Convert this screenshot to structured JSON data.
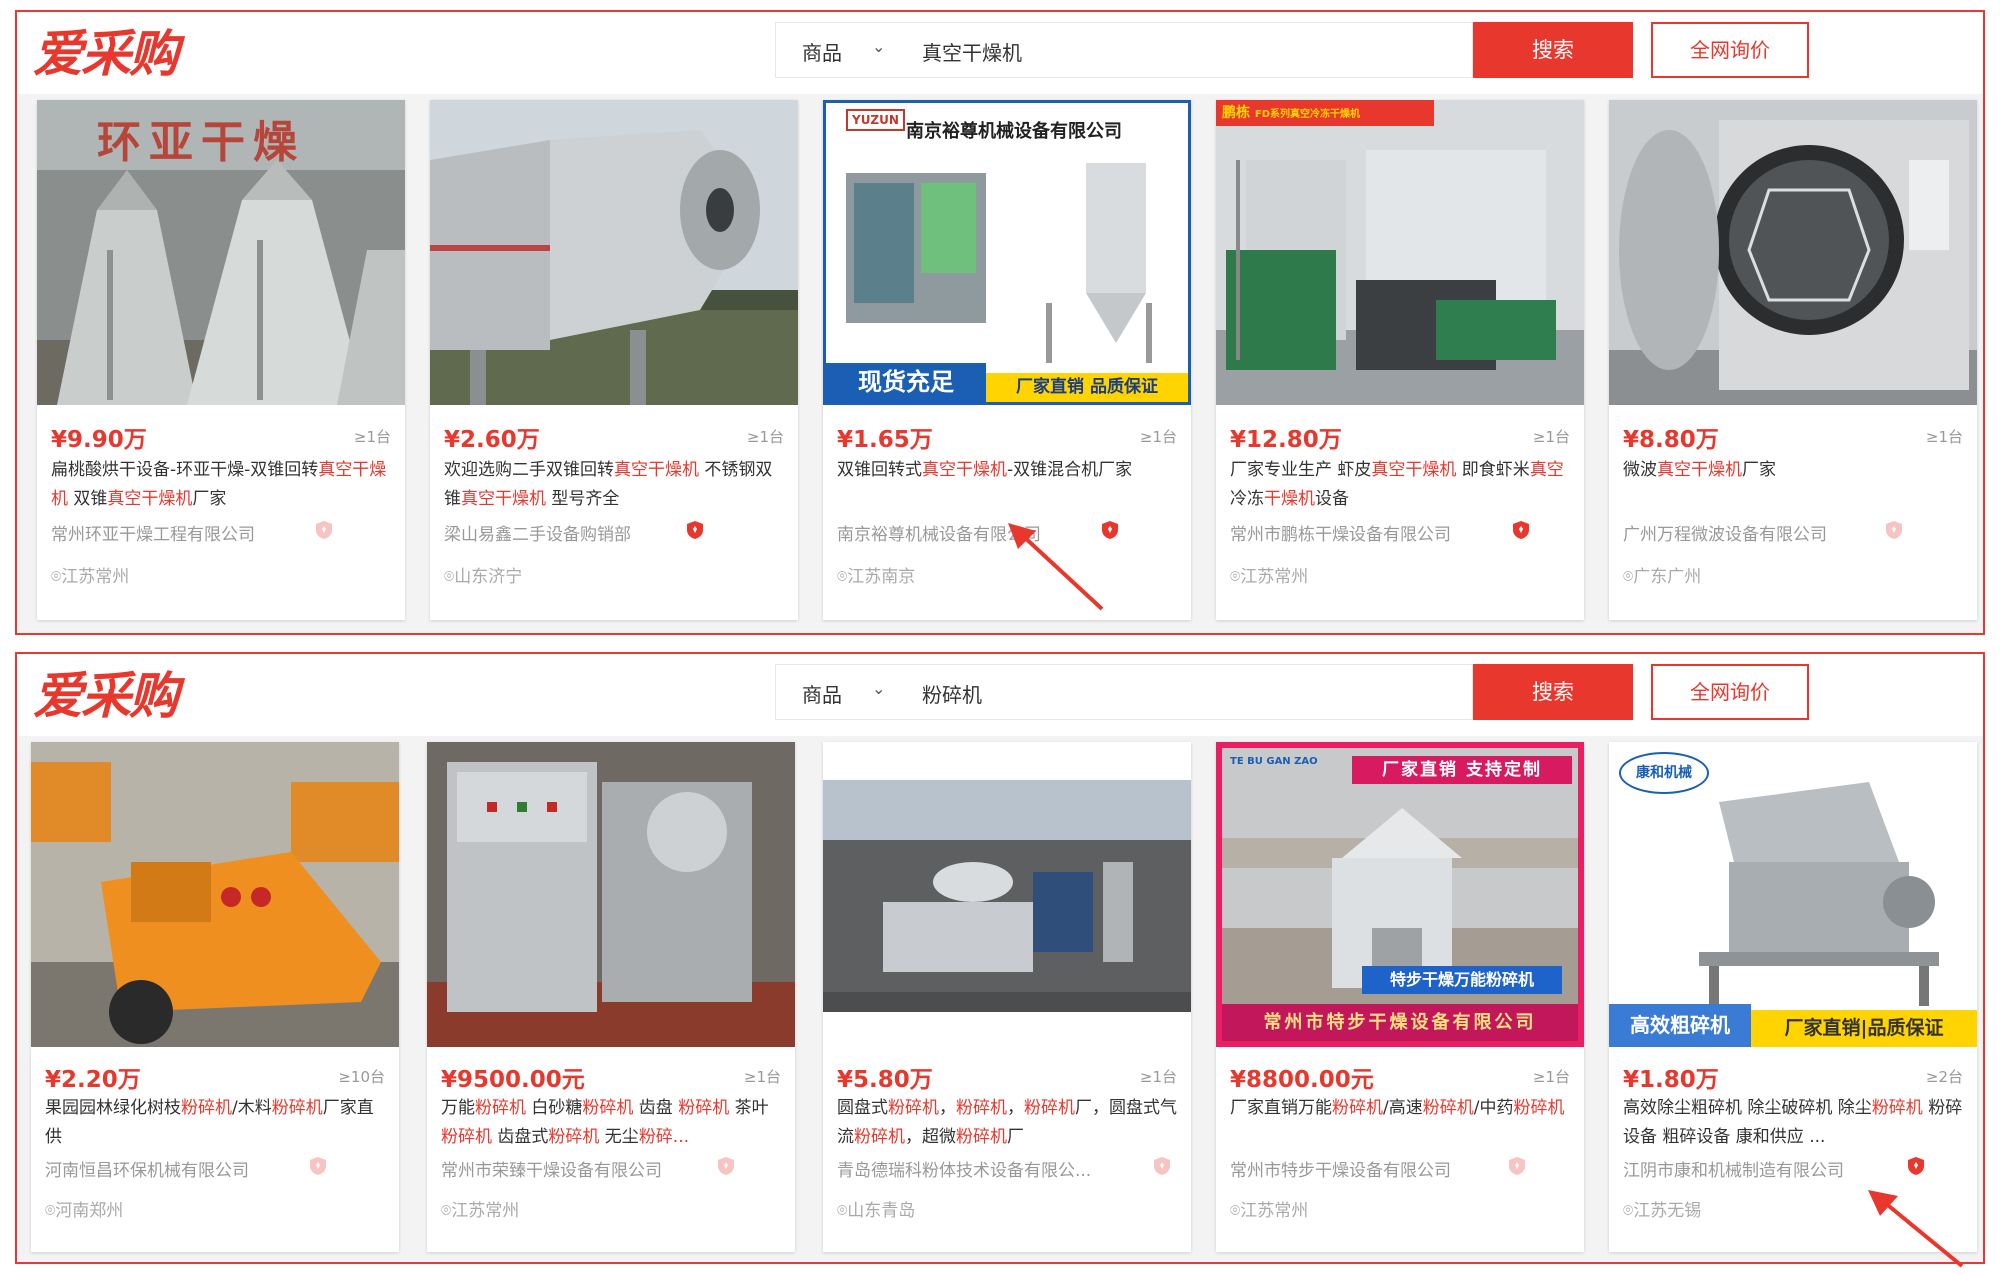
{
  "logo_text": "爱采购",
  "colors": {
    "brand_red": "#e8382d",
    "gray_text": "#999999"
  },
  "panels": [
    {
      "search": {
        "category": "商品",
        "keyword": "真空干燥机",
        "search_label": "搜索",
        "rfq_label": "全网询价"
      },
      "cards": [
        {
          "price": "¥9.90万",
          "min": "≥1台",
          "title": [
            {
              "t": "扁桃酸烘干设备-环亚干燥-双锥回转",
              "h": false
            },
            {
              "t": "真空干燥机",
              "h": true
            },
            {
              "t": " 双锥",
              "h": false
            },
            {
              "t": "真空干燥机",
              "h": true
            },
            {
              "t": "厂家",
              "h": false
            }
          ],
          "company": "常州环亚干燥工程有限公司",
          "shield": "pink",
          "location": "江苏常州",
          "image_text": "环亚干燥",
          "image": "cone-dryer"
        },
        {
          "price": "¥2.60万",
          "min": "≥1台",
          "title": [
            {
              "t": "欢迎选购二手双锥回转",
              "h": false
            },
            {
              "t": "真空干燥机",
              "h": true
            },
            {
              "t": " 不锈钢双锥",
              "h": false
            },
            {
              "t": "真空干燥机",
              "h": true
            },
            {
              "t": " 型号齐全",
              "h": false
            }
          ],
          "company": "梁山易鑫二手设备购销部",
          "shield": "red",
          "location": "山东济宁",
          "image": "double-cone"
        },
        {
          "price": "¥1.65万",
          "min": "≥1台",
          "title": [
            {
              "t": "双锥回转式",
              "h": false
            },
            {
              "t": "真空干燥机",
              "h": true
            },
            {
              "t": "-双锥混合机厂家",
              "h": false
            }
          ],
          "company": "南京裕尊机械设备有限公司",
          "shield": "red",
          "location": "江苏南京",
          "image_header": "南京裕尊机械设备有限公司",
          "image_logo": "YUZUN",
          "image_banner_1": "现货充足",
          "image_banner_2": "厂家直销  品质保证",
          "image": "spray-dryer"
        },
        {
          "price": "¥12.80万",
          "min": "≥1台",
          "title": [
            {
              "t": "厂家专业生产 虾皮",
              "h": false
            },
            {
              "t": "真空干燥机",
              "h": true
            },
            {
              "t": " 即食虾米",
              "h": false
            },
            {
              "t": "真空",
              "h": true
            },
            {
              "t": "冷冻",
              "h": false
            },
            {
              "t": "干燥机",
              "h": true
            },
            {
              "t": "设备",
              "h": false
            }
          ],
          "company": "常州市鹏栋干燥设备有限公司",
          "shield": "red",
          "location": "江苏常州",
          "image_tag": "鹏栋",
          "image_tag_2": "FD系列真空冷冻干燥机",
          "image": "freeze-dryer"
        },
        {
          "price": "¥8.80万",
          "min": "≥1台",
          "title": [
            {
              "t": "微波",
              "h": false
            },
            {
              "t": "真空干燥机",
              "h": true
            },
            {
              "t": "厂家",
              "h": false
            }
          ],
          "company": "广州万程微波设备有限公司",
          "shield": "pink",
          "location": "广东广州",
          "image": "microwave-dryer"
        }
      ]
    },
    {
      "search": {
        "category": "商品",
        "keyword": "粉碎机",
        "search_label": "搜索",
        "rfq_label": "全网询价"
      },
      "cards": [
        {
          "price": "¥2.20万",
          "min": "≥10台",
          "title": [
            {
              "t": "果园园林绿化树枝",
              "h": false
            },
            {
              "t": "粉碎机",
              "h": true
            },
            {
              "t": "/木料",
              "h": false
            },
            {
              "t": "粉碎机",
              "h": true
            },
            {
              "t": "厂家直供",
              "h": false
            }
          ],
          "company": "河南恒昌环保机械有限公司",
          "shield": "pink",
          "location": "河南郑州",
          "image": "wood-chipper"
        },
        {
          "price": "¥9500.00元",
          "min": "≥1台",
          "title": [
            {
              "t": "万能",
              "h": false
            },
            {
              "t": "粉碎机",
              "h": true
            },
            {
              "t": " 白砂糖",
              "h": false
            },
            {
              "t": "粉碎机",
              "h": true
            },
            {
              "t": " 齿盘 ",
              "h": false
            },
            {
              "t": "粉碎机",
              "h": true
            },
            {
              "t": " 茶叶",
              "h": false
            },
            {
              "t": "粉碎机",
              "h": true
            },
            {
              "t": " 齿盘式",
              "h": false
            },
            {
              "t": "粉碎机",
              "h": true
            },
            {
              "t": " 无尘",
              "h": false
            },
            {
              "t": "粉碎...",
              "h": true
            }
          ],
          "company": "常州市荣臻干燥设备有限公司",
          "shield": "pink",
          "location": "江苏常州",
          "image": "pulverizer"
        },
        {
          "price": "¥5.80万",
          "min": "≥1台",
          "title": [
            {
              "t": "圆盘式",
              "h": false
            },
            {
              "t": "粉碎机",
              "h": true
            },
            {
              "t": "，",
              "h": false
            },
            {
              "t": "粉碎机",
              "h": true
            },
            {
              "t": "，",
              "h": false
            },
            {
              "t": "粉碎机",
              "h": true
            },
            {
              "t": "厂，圆盘式气流",
              "h": false
            },
            {
              "t": "粉碎机",
              "h": true
            },
            {
              "t": "，超微",
              "h": false
            },
            {
              "t": "粉碎机",
              "h": true
            },
            {
              "t": "厂",
              "h": false
            }
          ],
          "company": "青岛德瑞科粉体技术设备有限公...",
          "shield": "pink",
          "location": "山东青岛",
          "image": "jet-mill"
        },
        {
          "price": "¥8800.00元",
          "min": "≥1台",
          "title": [
            {
              "t": "厂家直销万能",
              "h": false
            },
            {
              "t": "粉碎机",
              "h": true
            },
            {
              "t": "/高速",
              "h": false
            },
            {
              "t": "粉碎机",
              "h": true
            },
            {
              "t": "/中药",
              "h": false
            },
            {
              "t": "粉碎机",
              "h": true
            }
          ],
          "company": "常州市特步干燥设备有限公司",
          "shield": "pink",
          "location": "江苏常州",
          "image_banner_top": "厂家直销  支持定制",
          "image_label": "特步干燥万能粉碎机",
          "image_footer": "常州市特步干燥设备有限公司",
          "image_logo": "TE BU GAN ZAO",
          "image": "universal-mill"
        },
        {
          "price": "¥1.80万",
          "min": "≥2台",
          "title": [
            {
              "t": "高效除尘粗碎机 除尘破碎机 除尘",
              "h": false
            },
            {
              "t": "粉碎机",
              "h": true
            },
            {
              "t": " 粉碎设备 粗碎设备 康和供应 ...",
              "h": false
            }
          ],
          "company": "江阴市康和机械制造有限公司",
          "shield": "red",
          "location": "江苏无锡",
          "image_logo": "康和机械",
          "image_banner_1": "高效粗碎机",
          "image_banner_2": "厂家直销|品质保证",
          "image": "coarse-crusher"
        }
      ]
    }
  ]
}
